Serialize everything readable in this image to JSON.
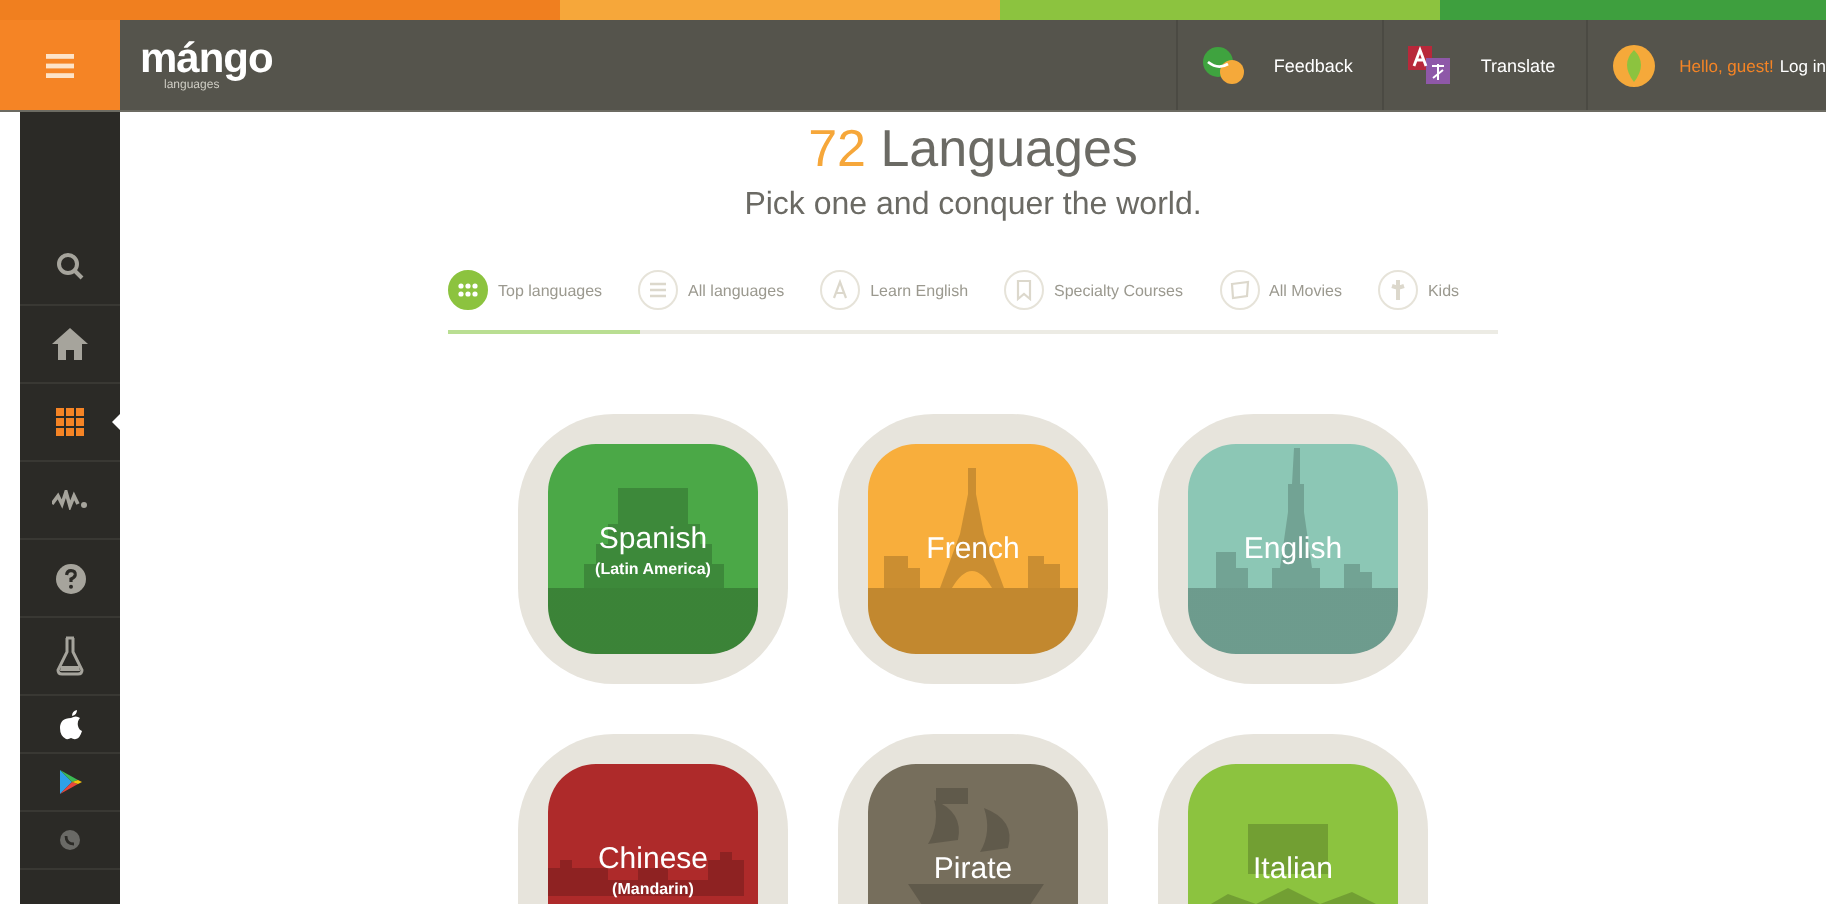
{
  "header": {
    "logo": "mángo",
    "logo_sub": "languages",
    "actions": [
      {
        "kind": "feedback",
        "label": "Feedback"
      },
      {
        "kind": "translate",
        "label": "Translate"
      }
    ],
    "greeting": "Hello, guest!",
    "login": "Log in"
  },
  "sidebar": {
    "items": [
      {
        "kind": "search",
        "selected": false
      },
      {
        "kind": "home",
        "selected": false
      },
      {
        "kind": "grid",
        "selected": true
      },
      {
        "kind": "wave",
        "selected": false
      },
      {
        "kind": "help",
        "selected": false
      },
      {
        "kind": "flask",
        "selected": false
      },
      {
        "kind": "apple",
        "selected": false
      },
      {
        "kind": "play",
        "selected": false
      },
      {
        "kind": "phone",
        "selected": false
      }
    ]
  },
  "heading": {
    "count": "72",
    "title": "Languages",
    "subtitle": "Pick one and conquer the world."
  },
  "tabs": [
    {
      "kind": "grid",
      "label": "Top languages",
      "selected": true
    },
    {
      "kind": "list",
      "label": "All languages",
      "selected": false
    },
    {
      "kind": "letter",
      "label": "Learn English",
      "selected": false
    },
    {
      "kind": "bookmark",
      "label": "Specialty Courses",
      "selected": false
    },
    {
      "kind": "film",
      "label": "All Movies",
      "selected": false
    },
    {
      "kind": "kid",
      "label": "Kids",
      "selected": false
    }
  ],
  "languages": [
    {
      "name": "Spanish",
      "variant": "(Latin America)",
      "color": "#4ba847",
      "kind": "pyramid"
    },
    {
      "name": "French",
      "color": "#f8ae3c",
      "kind": "tower"
    },
    {
      "name": "English",
      "color": "#8cc7b5",
      "kind": "statue"
    },
    {
      "name": "Chinese",
      "variant": "(Mandarin)",
      "color": "#ae2a2a",
      "kind": "wall"
    },
    {
      "name": "Pirate",
      "color": "#766e5c",
      "kind": "ship"
    },
    {
      "name": "Italian",
      "color": "#8cc33f",
      "kind": "colosseum"
    }
  ]
}
